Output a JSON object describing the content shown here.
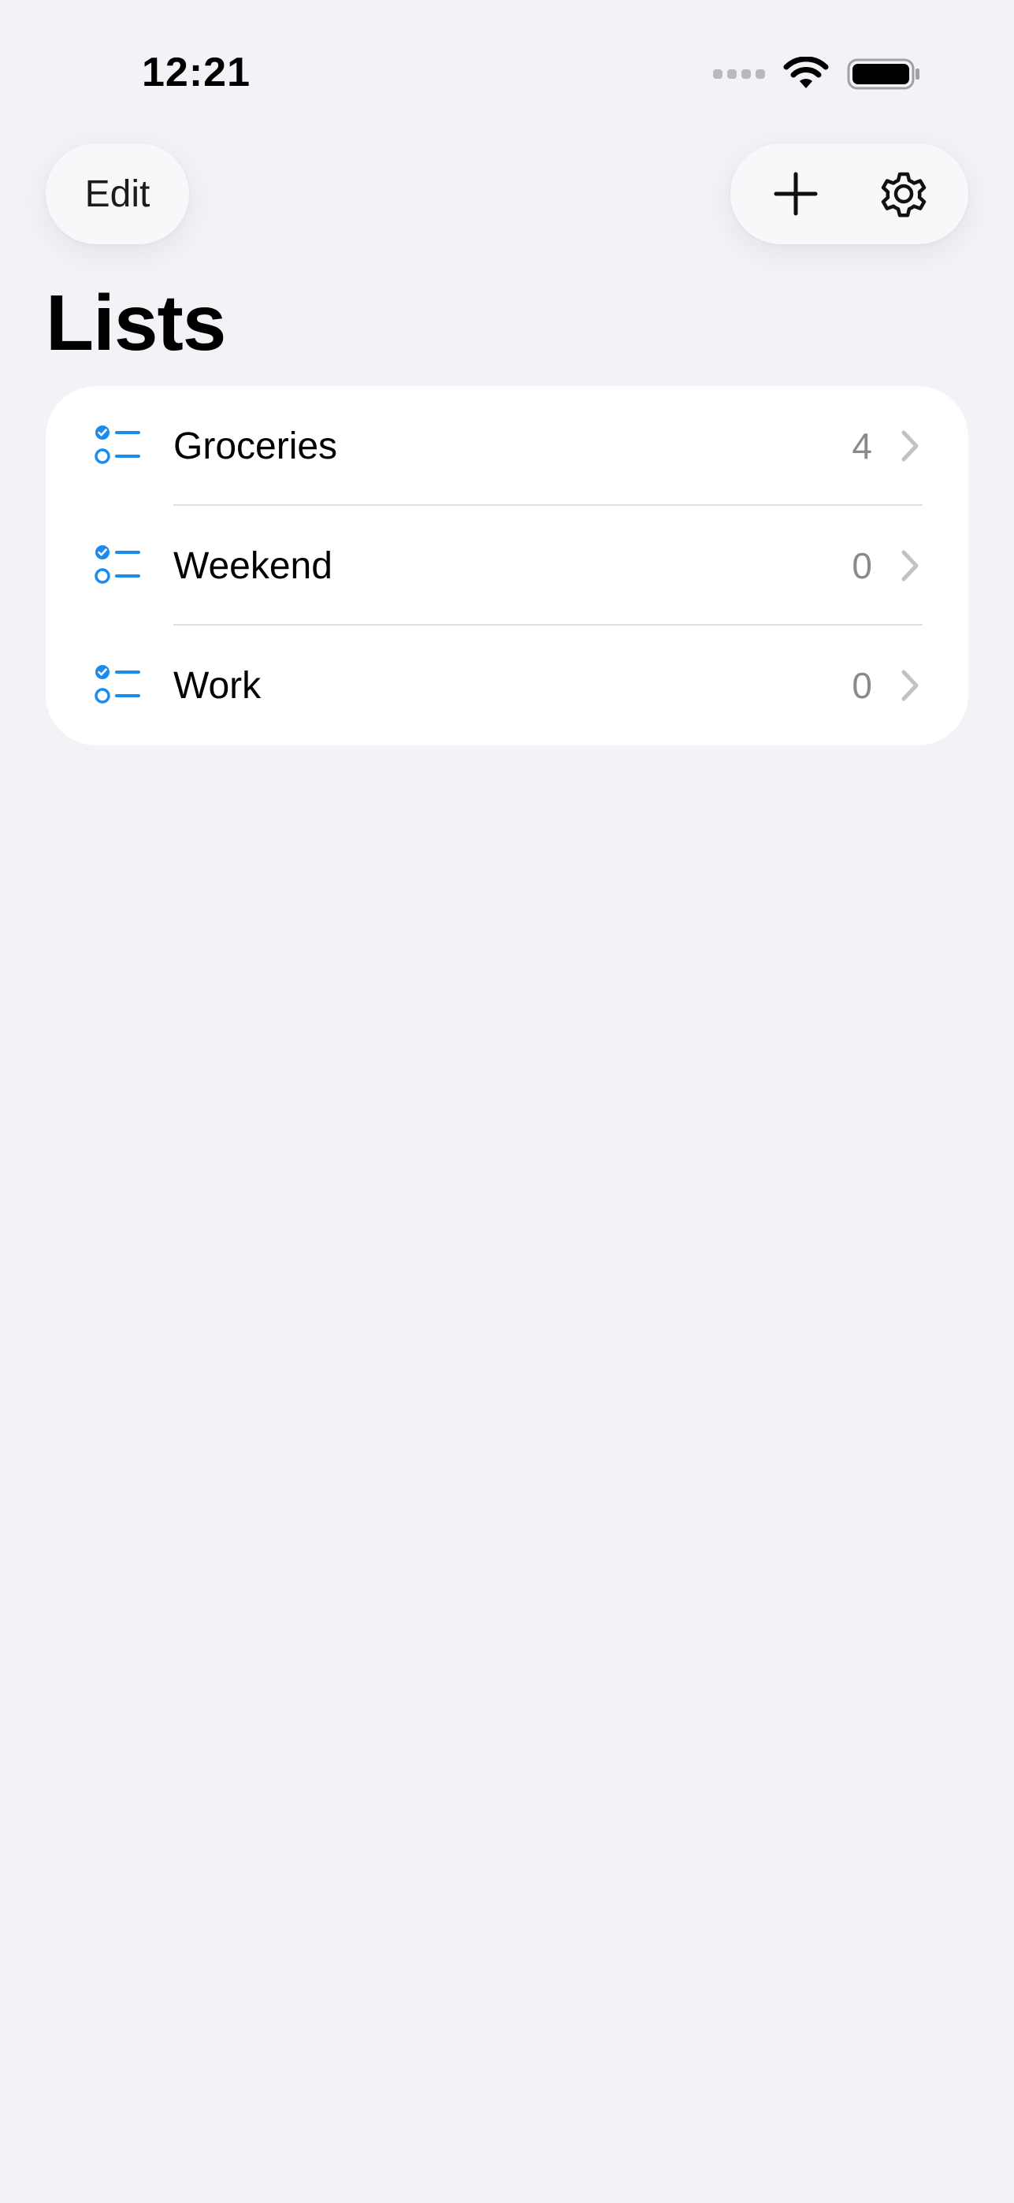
{
  "status_bar": {
    "time": "12:21"
  },
  "toolbar": {
    "edit_label": "Edit",
    "add_icon": "plus-icon",
    "settings_icon": "gear-icon"
  },
  "page": {
    "title": "Lists"
  },
  "lists": [
    {
      "label": "Groceries",
      "count": "4",
      "icon": "checklist-icon"
    },
    {
      "label": "Weekend",
      "count": "0",
      "icon": "checklist-icon"
    },
    {
      "label": "Work",
      "count": "0",
      "icon": "checklist-icon"
    }
  ],
  "colors": {
    "accent": "#1a8cf0",
    "background": "#f2f2f7",
    "card": "#ffffff",
    "secondary_text": "#8a8a8e"
  }
}
